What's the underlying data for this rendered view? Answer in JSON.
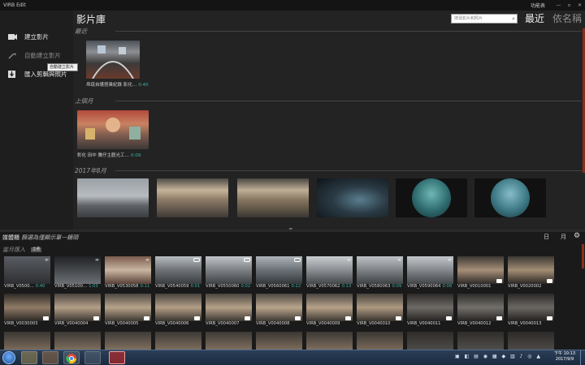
{
  "window": {
    "title": "VIRB Edit",
    "menu_label": "功能表",
    "controls": [
      "—",
      "▫",
      "✕"
    ]
  },
  "sidebar": {
    "items": [
      {
        "label": "建立影片",
        "icon": "camera-icon",
        "enabled": true
      },
      {
        "label": "自動建立影片",
        "icon": "magic-wand-icon",
        "enabled": false
      },
      {
        "label": "匯入剪輯與照片",
        "icon": "import-icon",
        "enabled": true
      }
    ],
    "tooltip": "自動建立影片"
  },
  "library": {
    "title": "影片庫",
    "search_placeholder": "搜尋影片和照片",
    "sort_recent": "最近",
    "sort_name": "依名稱",
    "sections": [
      {
        "label": "最近",
        "items": [
          {
            "caption": "帛琉自護搭乘紀錄 影化…",
            "duration": "0:40"
          }
        ]
      },
      {
        "label": "上個月",
        "items": [
          {
            "caption": "彰化 田中 騰仔主觀光工…",
            "duration": "0:09"
          }
        ]
      },
      {
        "label": "2017年8月",
        "items": [
          {
            "caption": ""
          },
          {
            "caption": ""
          },
          {
            "caption": ""
          },
          {
            "caption": ""
          },
          {
            "caption": ""
          },
          {
            "caption": ""
          }
        ]
      }
    ]
  },
  "media": {
    "title": "媒體櫃",
    "subtitle": "篩選為僅顯示單一鏡頭",
    "view_day": "日",
    "view_month": "月",
    "group_label": "當月匯入",
    "group_badge": "全選",
    "row1": [
      {
        "name": "VIRB_V0500…",
        "duration": "0:40",
        "type": "video360"
      },
      {
        "name": "VIRB_V05100…",
        "duration": "1:03",
        "type": "video360"
      },
      {
        "name": "VIRB_V0530058",
        "duration": "0:11",
        "type": "video360"
      },
      {
        "name": "VIRB_V0540059",
        "duration": "0:01",
        "type": "video"
      },
      {
        "name": "VIRB_V0550060",
        "duration": "0:02",
        "type": "video"
      },
      {
        "name": "VIRB_V0560061",
        "duration": "0:22",
        "type": "video"
      },
      {
        "name": "VIRB_V0570062",
        "duration": "0:13",
        "type": "video360"
      },
      {
        "name": "VIRB_V0580063",
        "duration": "0:09",
        "type": "video360"
      },
      {
        "name": "VIRB_V0590064",
        "duration": "0:08",
        "type": "video360"
      },
      {
        "name": "VIRB_V0010001",
        "duration": "",
        "type": "photo"
      },
      {
        "name": "VIRB_V0020002",
        "duration": "",
        "type": "photo"
      }
    ],
    "row2": [
      {
        "name": "VIRB_V0030003",
        "duration": "",
        "type": "photo"
      },
      {
        "name": "VIRB_V0040004",
        "duration": "",
        "type": "photo"
      },
      {
        "name": "VIRB_V0040005",
        "duration": "",
        "type": "photo"
      },
      {
        "name": "VIRB_V0040006",
        "duration": "",
        "type": "photo"
      },
      {
        "name": "VIRB_V0040007",
        "duration": "",
        "type": "photo"
      },
      {
        "name": "VIRB_V0040008",
        "duration": "",
        "type": "photo"
      },
      {
        "name": "VIRB_V0040009",
        "duration": "",
        "type": "photo"
      },
      {
        "name": "VIRB_V0040010",
        "duration": "",
        "type": "photo"
      },
      {
        "name": "VIRB_V0040011",
        "duration": "",
        "type": "photo"
      },
      {
        "name": "VIRB_V0040012",
        "duration": "",
        "type": "photo"
      },
      {
        "name": "VIRB_V0040013",
        "duration": "",
        "type": "photo"
      }
    ]
  },
  "taskbar": {
    "clock_time": "下午 10:13",
    "clock_date": "2017/9/9",
    "apps": [
      "file-explorer",
      "media-player",
      "chrome",
      "browser",
      "virb-edit"
    ]
  },
  "colors": {
    "accent": "#8b2e1a",
    "duration_teal": "#3fb0a6"
  }
}
